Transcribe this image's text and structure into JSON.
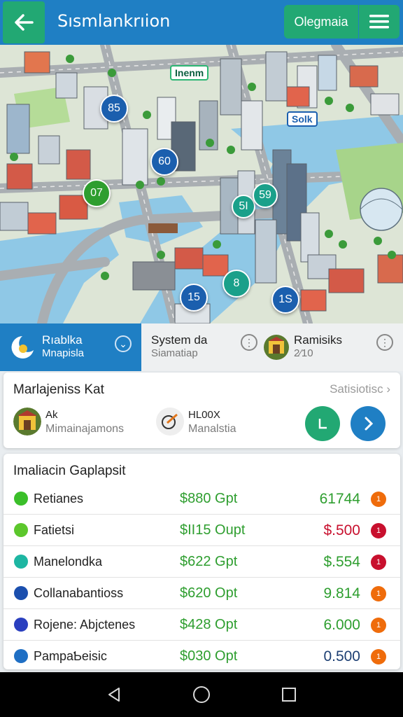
{
  "header": {
    "title": "Sısmlankrıion",
    "action_label": "Olegmaia",
    "icons": {
      "back": "arrow-left-icon",
      "menu": "hamburger-menu-icon"
    }
  },
  "map": {
    "tag_label": "Inenm",
    "poi_label": "Solk",
    "markers": [
      {
        "label": "85",
        "color": "blue"
      },
      {
        "label": "60",
        "color": "blue"
      },
      {
        "label": "07",
        "color": "green"
      },
      {
        "label": "5I",
        "color": "teal"
      },
      {
        "label": "59",
        "color": "teal"
      },
      {
        "label": "8",
        "color": "teal"
      },
      {
        "label": "15",
        "color": "blue"
      },
      {
        "label": "1S",
        "color": "blue"
      }
    ]
  },
  "tabs": [
    {
      "title": "Rıablka",
      "sub": "Mnapisla"
    },
    {
      "title": "System da",
      "sub": "Siamatiap"
    },
    {
      "title": "Ramisiks",
      "sub": "2⁄10"
    }
  ],
  "summary_card": {
    "title": "Marlajeniss Kat",
    "link": "Satisiotisc",
    "people": [
      {
        "name": "Ak",
        "sub": "Mimainajamons"
      },
      {
        "name": "HL00X",
        "sub": "Manalstia"
      }
    ]
  },
  "list": {
    "title": "Imaliacin Gaplapsit",
    "rows": [
      {
        "name": "Retianes",
        "price": "$880 Gpt",
        "value": "61744",
        "badge": "1",
        "dot_color": "#3bbf2a",
        "value_color": "#2e9e2f",
        "badge_color": "#ef6c0b"
      },
      {
        "name": "Fatietsi",
        "price": "$II15 Oupt",
        "value": "$.500",
        "badge": "1",
        "dot_color": "#5cc72c",
        "value_color": "#c8102e",
        "badge_color": "#c8102e"
      },
      {
        "name": "Manelondka",
        "price": "$622 Gpt",
        "value": "$.554",
        "badge": "1",
        "dot_color": "#1db6a2",
        "value_color": "#2e9e2f",
        "badge_color": "#c8102e"
      },
      {
        "name": "Collanabantioss",
        "price": "$620 Opt",
        "value": "9.814",
        "badge": "1",
        "dot_color": "#1b4fae",
        "value_color": "#2e9e2f",
        "badge_color": "#ef6c0b"
      },
      {
        "name": "Rojene: Abjctenes",
        "price": "$428 Opt",
        "value": "6.000",
        "badge": "1",
        "dot_color": "#2a3fbf",
        "value_color": "#2e9e2f",
        "badge_color": "#ef6c0b"
      },
      {
        "name": "PampaƄeisic",
        "price": "$030 Opt",
        "value": "0.500",
        "badge": "1",
        "dot_color": "#1f6fc4",
        "value_color": "#1d3f73",
        "badge_color": "#ef6c0b"
      }
    ]
  },
  "colors": {
    "primary_blue": "#1f7fc4",
    "accent_green": "#22a873"
  }
}
